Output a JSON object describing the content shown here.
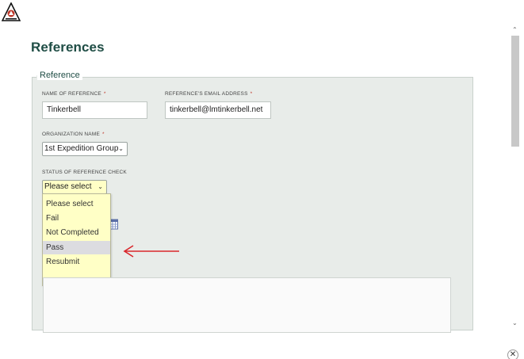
{
  "header": {
    "logo_icon": "triangle-emblem-icon"
  },
  "page": {
    "title": "References"
  },
  "section": {
    "legend": "Reference"
  },
  "fields": {
    "name_label": "NAME OF REFERENCE",
    "name_value": "Tinkerbell",
    "email_label": "REFERENCE'S EMAIL ADDRESS",
    "email_value": "tinkerbell@lmtinkerbell.net",
    "org_label": "ORGANIZATION NAME",
    "org_value": "1st Expedition Group",
    "status_label": "STATUS OF REFERENCE CHECK",
    "status_value": "Please select",
    "required_mark": "*"
  },
  "dropdown": {
    "options": [
      "Please select",
      "Fail",
      "Not Completed",
      "Pass",
      "Resubmit"
    ],
    "highlighted": "Pass"
  },
  "colors": {
    "title": "#1f4d45",
    "panel": "#e8ece9",
    "dropdown_bg": "#ffffc6",
    "arrow": "#d9262b",
    "required": "#c0392b"
  },
  "icons": {
    "calendar": "calendar-icon",
    "arrow": "left-arrow-icon",
    "close": "close-icon"
  }
}
